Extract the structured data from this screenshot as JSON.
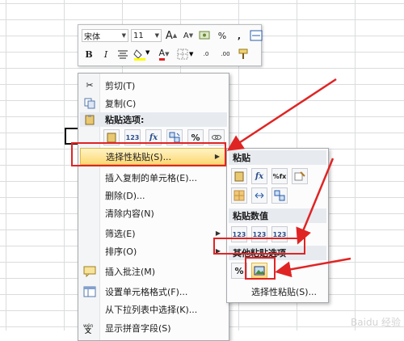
{
  "mini_toolbar": {
    "font_name": "宋体",
    "font_size": "11",
    "grow_font": "A",
    "shrink_font": "A",
    "percent": "%",
    "comma": ",",
    "bold": "B",
    "italic": "I",
    "font_color_letter": "A",
    "dec_increase": ".0",
    "dec_decrease": ".00"
  },
  "context_menu": {
    "items": [
      {
        "label": "剪切(T)",
        "icon": "scissors-icon"
      },
      {
        "label": "复制(C)",
        "icon": "copy-icon"
      },
      {
        "label": "粘贴选项:",
        "icon": "paste-icon"
      },
      {
        "label": "选择性粘贴(S)...",
        "icon": ""
      },
      {
        "label": "插入复制的单元格(E)...",
        "icon": ""
      },
      {
        "label": "删除(D)...",
        "icon": ""
      },
      {
        "label": "清除内容(N)",
        "icon": ""
      },
      {
        "label": "筛选(E)",
        "icon": ""
      },
      {
        "label": "排序(O)",
        "icon": ""
      },
      {
        "label": "插入批注(M)",
        "icon": "comment-icon"
      },
      {
        "label": "设置单元格格式(F)...",
        "icon": "format-cells-icon"
      },
      {
        "label": "从下拉列表中选择(K)...",
        "icon": ""
      },
      {
        "label": "显示拼音字段(S)",
        "icon": "phonetic-icon"
      }
    ],
    "paste_buttons": [
      "paste",
      "123",
      "fx",
      "transpose",
      "%",
      "link"
    ]
  },
  "submenu": {
    "section_paste": "粘贴",
    "section_values": "粘贴数值",
    "section_other": "其他粘贴选项",
    "footer": "选择性粘贴(S)...",
    "paste_buttons_row1": [
      "paste",
      "fx",
      "%fx",
      "brush"
    ],
    "paste_buttons_row2": [
      "noborder",
      "columnwidth",
      "transpose"
    ],
    "value_buttons": [
      "123",
      "123",
      "123"
    ],
    "other_buttons": [
      "%",
      "picture"
    ]
  },
  "watermark": "Baidu 经验",
  "colors": {
    "annotation": "#e02424",
    "highlight": "#fcd974",
    "section_bg": "#e7ebf0"
  }
}
